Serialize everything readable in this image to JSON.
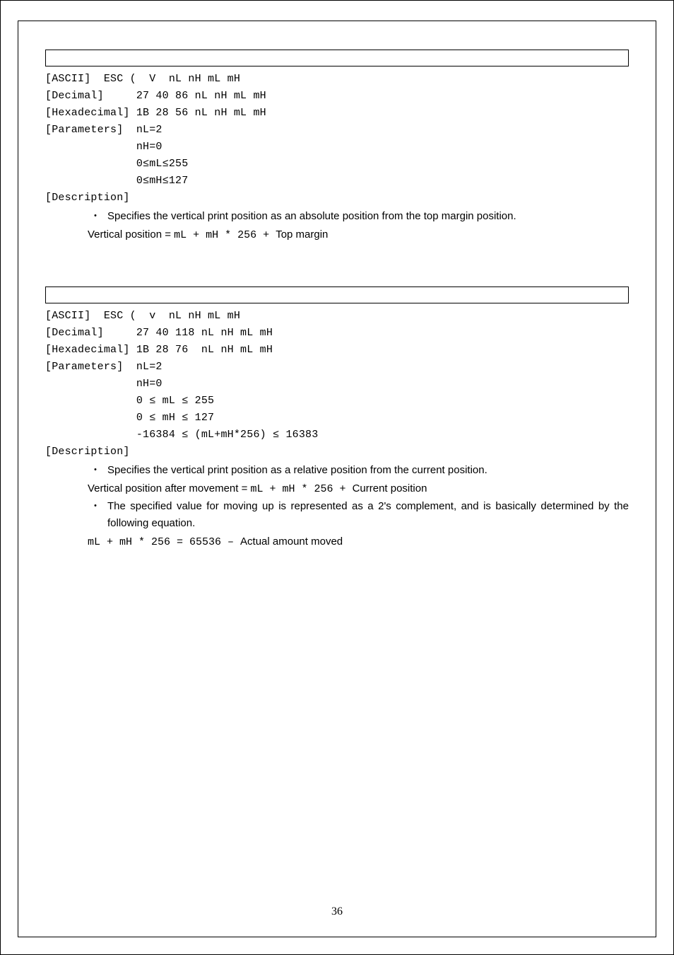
{
  "section1": {
    "ascii": "[ASCII]  ESC (  V  nL nH mL mH",
    "decimal": "[Decimal]     27 40 86 nL nH mL mH",
    "hex": "[Hexadecimal] 1B 28 56 nL nH mL mH",
    "params_label": "[Parameters]  nL=2",
    "p1": "              nH=0",
    "p2": "              0≤mL≤255",
    "p3": "              0≤mH≤127",
    "desc_label": "[Description]",
    "bullet1": "Specifies the vertical print position as an absolute position from the top margin position.",
    "formula_prefix": "Vertical position  = ",
    "formula_mono": " mL + mH * 256 + ",
    "formula_suffix": "Top margin"
  },
  "section2": {
    "ascii": "[ASCII]  ESC (  v  nL nH mL mH",
    "decimal": "[Decimal]     27 40 118 nL nH mL mH",
    "hex": "[Hexadecimal] 1B 28 76  nL nH mL mH",
    "params_label": "[Parameters]  nL=2",
    "p1": "              nH=0",
    "p2": "              0 ≤ mL ≤ 255",
    "p3": "              0 ≤ mH ≤ 127",
    "p4": "              -16384 ≤ (mL+mH*256) ≤ 16383",
    "desc_label": "[Description]",
    "bullet1": "Specifies the vertical print position as a relative position from the current position.",
    "formula1_prefix": "Vertical position after movement = ",
    "formula1_mono": " mL + mH * 256 + ",
    "formula1_suffix": "Current position",
    "bullet2a": "The specified value for moving up is represented as a ",
    "bullet2_mono": "2",
    "bullet2b": "'s complement, and is basically determined by the following equation.",
    "formula2_mono": "mL + mH * 256 = 65536 – ",
    "formula2_suffix": "Actual amount moved"
  },
  "page_number": "36"
}
